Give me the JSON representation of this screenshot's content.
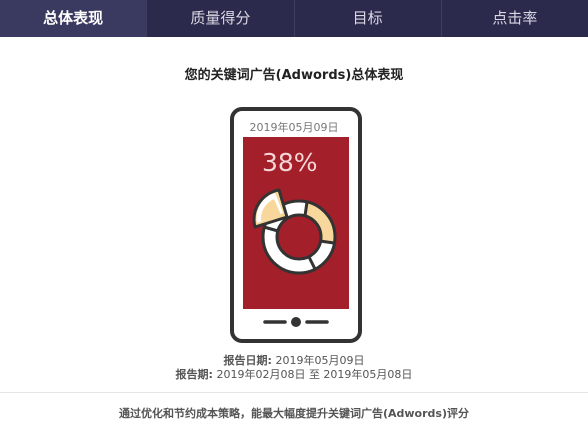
{
  "tabs": [
    {
      "label": "总体表现",
      "active": true
    },
    {
      "label": "质量得分",
      "active": false
    },
    {
      "label": "目标",
      "active": false
    },
    {
      "label": "点击率",
      "active": false
    }
  ],
  "title": "您的关键词广告(Adwords)总体表现",
  "phone": {
    "date": "2019年05月09日",
    "percent_label": "38%",
    "percent_value": 0.38,
    "screen_color": "#a31f2a"
  },
  "report": {
    "date_label": "报告日期:",
    "date_value": "2019年05月09日",
    "period_label": "报告期:",
    "period_value": "2019年02月08日 至 2019年05月08日"
  },
  "footer": "通过优化和节约成本策略，能最大幅度提升关键词广告(Adwords)评分",
  "colors": {
    "tabbar": "#2b2a4c",
    "accent_red": "#a31f2a",
    "highlight_yellow": "#f7d79b"
  }
}
